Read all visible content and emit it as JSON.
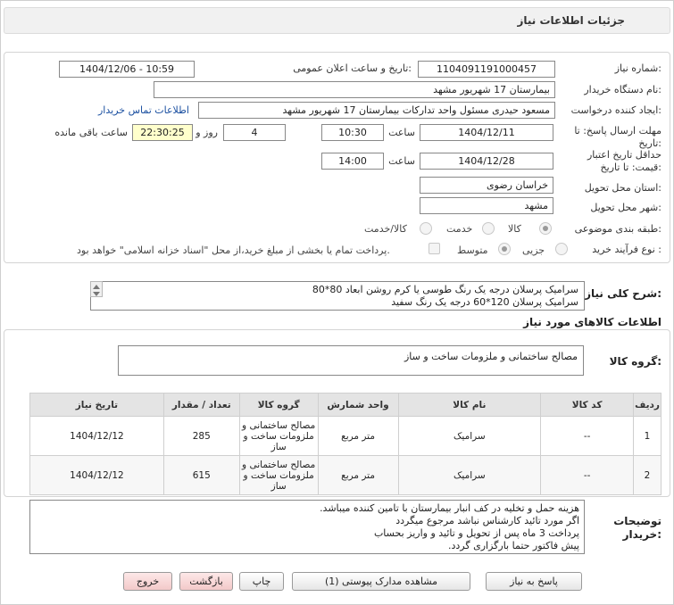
{
  "header": {
    "title": "جزئیات اطلاعات نیاز"
  },
  "info": {
    "need_number_label": "شماره نیاز:",
    "need_number": "1104091191000457",
    "announce_label": "تاریخ و ساعت اعلان عمومی:",
    "announce_value": "1404/12/06 - 10:59",
    "buyer_org_label": "نام دستگاه خریدار:",
    "buyer_org": "بیمارستان 17 شهریور مشهد",
    "requester_label": "ایجاد کننده درخواست:",
    "requester": "مسعود حیدری مسئول واحد تدارکات  بیمارستان 17 شهریور مشهد",
    "contact_link": "اطلاعات تماس خریدار",
    "deadline_label_1": "مهلت ارسال پاسخ: تا",
    "deadline_label_2": "تاریخ:",
    "deadline_date": "1404/12/11",
    "time_label": "ساعت",
    "deadline_time": "10:30",
    "days_value": "4",
    "days_label": "روز و",
    "remaining_time": "22:30:25",
    "remaining_label": "ساعت باقی مانده",
    "validity_label_1": "حداقل تاریخ اعتبار",
    "validity_label_2": "قیمت: تا تاریخ:",
    "validity_date": "1404/12/28",
    "validity_time_label": "ساعت",
    "validity_time": "14:00",
    "province_label": "استان محل تحویل:",
    "province": "خراسان رضوی",
    "city_label": "شهر محل تحویل:",
    "city": "مشهد",
    "category_label": "طبقه بندی موضوعی:",
    "category_options": [
      "کالا",
      "خدمت",
      "کالا/خدمت"
    ],
    "process_label": "نوع فرآیند خرید :",
    "process_options": [
      "جزیی",
      "متوسط"
    ],
    "payment_note": "پرداخت تمام یا بخشی از مبلغ خرید،از محل \"اسناد خزانه اسلامی\" خواهد بود."
  },
  "summary": {
    "label": "شرح کلی نیاز:",
    "lines": [
      "سرامیک پرسلان درجه یک رنگ طوسی یا کرم روشن ابعاد 80*80",
      "سرامیک پرسلان 120*60 درجه یک رنگ سفید"
    ]
  },
  "goods": {
    "section_title": "اطلاعات کالاهای مورد نیاز",
    "group_label": "گروه کالا:",
    "group_value": "مصالح ساختمانی و ملزومات ساخت و ساز",
    "columns": [
      "ردیف",
      "کد کالا",
      "نام کالا",
      "واحد شمارش",
      "گروه کالا",
      "تعداد / مقدار",
      "تاریخ نیاز"
    ],
    "rows": [
      {
        "index": "1",
        "code": "--",
        "name": "سرامیک",
        "unit": "متر مربع",
        "group": "مصالح ساختمانی و ملزومات ساخت و ساز",
        "qty": "285",
        "date": "1404/12/12"
      },
      {
        "index": "2",
        "code": "--",
        "name": "سرامیک",
        "unit": "متر مربع",
        "group": "مصالح ساختمانی و ملزومات ساخت و ساز",
        "qty": "615",
        "date": "1404/12/12"
      }
    ]
  },
  "buyer_notes": {
    "label_1": "توضیحات",
    "label_2": "خریدار:",
    "lines": [
      "هزینه حمل و تخلیه در کف انبار بیمارستان با تامین کننده میباشد.",
      "اگر مورد تائید کارشناس نباشد مرجوع میگردد",
      "پرداخت 3 ماه پس از تحویل و تائید و واریز بحساب",
      "پیش فاکتور حتما بارگزاری گردد."
    ]
  },
  "buttons": {
    "reply": "پاسخ به نیاز",
    "attachments": "مشاهده مدارک پیوستی (1)",
    "print": "چاپ",
    "back": "بازگشت",
    "exit": "خروج"
  }
}
